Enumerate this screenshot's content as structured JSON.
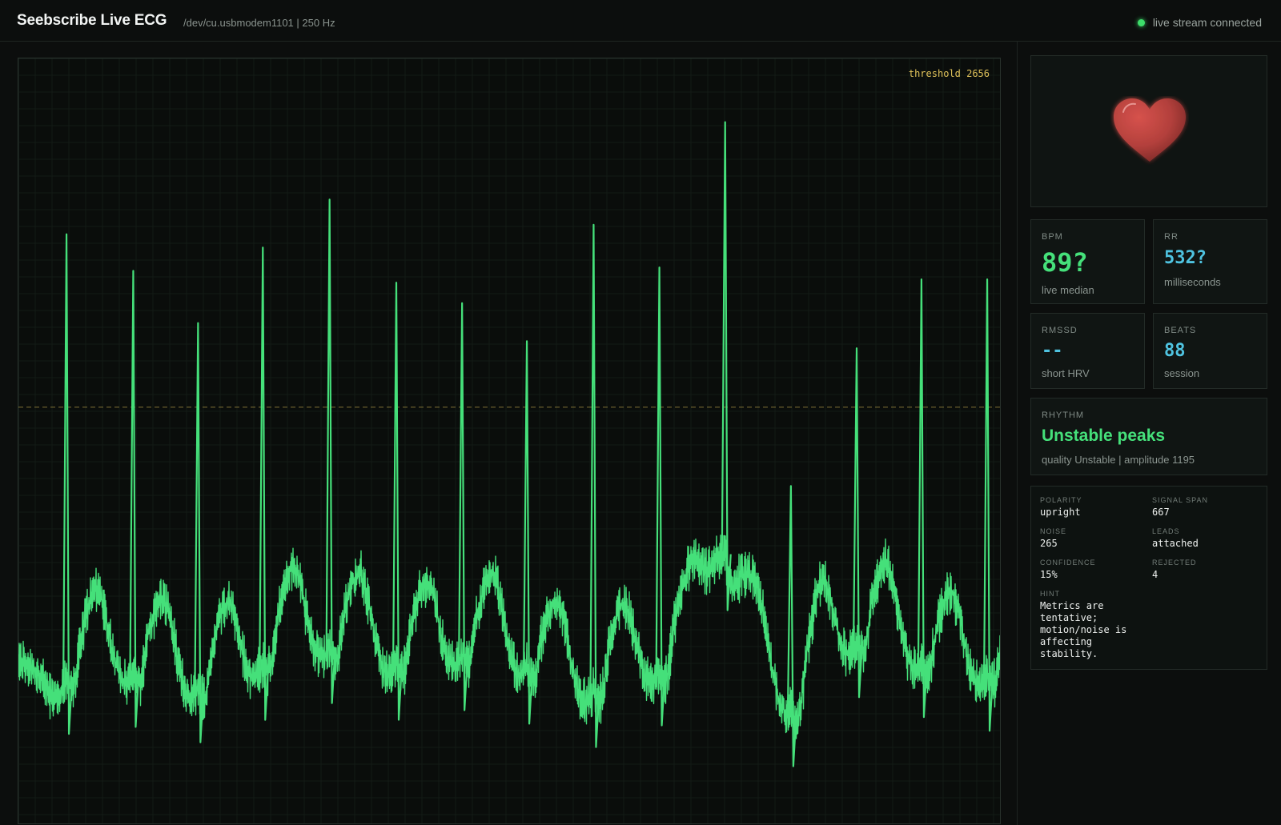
{
  "header": {
    "title": "Seebscribe Live ECG",
    "subtitle": "/dev/cu.usbmodem1101 | 250 Hz",
    "status_text": "live stream connected",
    "status_color": "#3ddc6a"
  },
  "plot": {
    "threshold_label": "threshold 2656",
    "threshold_color": "#e0c25a",
    "trace_color": "#45e07a",
    "threshold_value": 2656,
    "y_range": [
      1780,
      3390
    ],
    "r_peaks": [
      {
        "x": 0.049,
        "y": 3020
      },
      {
        "x": 0.117,
        "y": 2943
      },
      {
        "x": 0.183,
        "y": 2833
      },
      {
        "x": 0.249,
        "y": 2992
      },
      {
        "x": 0.317,
        "y": 3093
      },
      {
        "x": 0.385,
        "y": 2918
      },
      {
        "x": 0.452,
        "y": 2875
      },
      {
        "x": 0.518,
        "y": 2795
      },
      {
        "x": 0.586,
        "y": 3040
      },
      {
        "x": 0.653,
        "y": 2950
      },
      {
        "x": 0.72,
        "y": 3256
      },
      {
        "x": 0.787,
        "y": 2490
      },
      {
        "x": 0.854,
        "y": 2780
      },
      {
        "x": 0.92,
        "y": 2925
      },
      {
        "x": 0.987,
        "y": 2925
      }
    ]
  },
  "heart": {
    "icon": "heart-icon",
    "color": "#b3403c"
  },
  "metrics": {
    "bpm": {
      "label": "BPM",
      "value": "89?",
      "sub": "live median",
      "color": "#45e07a"
    },
    "rr": {
      "label": "RR",
      "value": "532?",
      "sub": "milliseconds",
      "color": "#4fc3e0"
    },
    "rmssd": {
      "label": "RMSSD",
      "value": "--",
      "sub": "short HRV",
      "color": "#4fc3e0"
    },
    "beats": {
      "label": "BEATS",
      "value": "88",
      "sub": "session",
      "color": "#4fc3e0"
    }
  },
  "rhythm": {
    "label": "RHYTHM",
    "value": "Unstable peaks",
    "sub": "quality Unstable | amplitude 1195"
  },
  "details": {
    "polarity": {
      "label": "POLARITY",
      "value": "upright"
    },
    "signal_span": {
      "label": "SIGNAL SPAN",
      "value": "667"
    },
    "noise": {
      "label": "NOISE",
      "value": "265"
    },
    "leads": {
      "label": "LEADS",
      "value": "attached"
    },
    "confidence": {
      "label": "CONFIDENCE",
      "value": "15%"
    },
    "rejected": {
      "label": "REJECTED",
      "value": "4"
    },
    "hint": {
      "label": "HINT",
      "value": "Metrics are tentative; motion/noise is affecting stability."
    }
  }
}
